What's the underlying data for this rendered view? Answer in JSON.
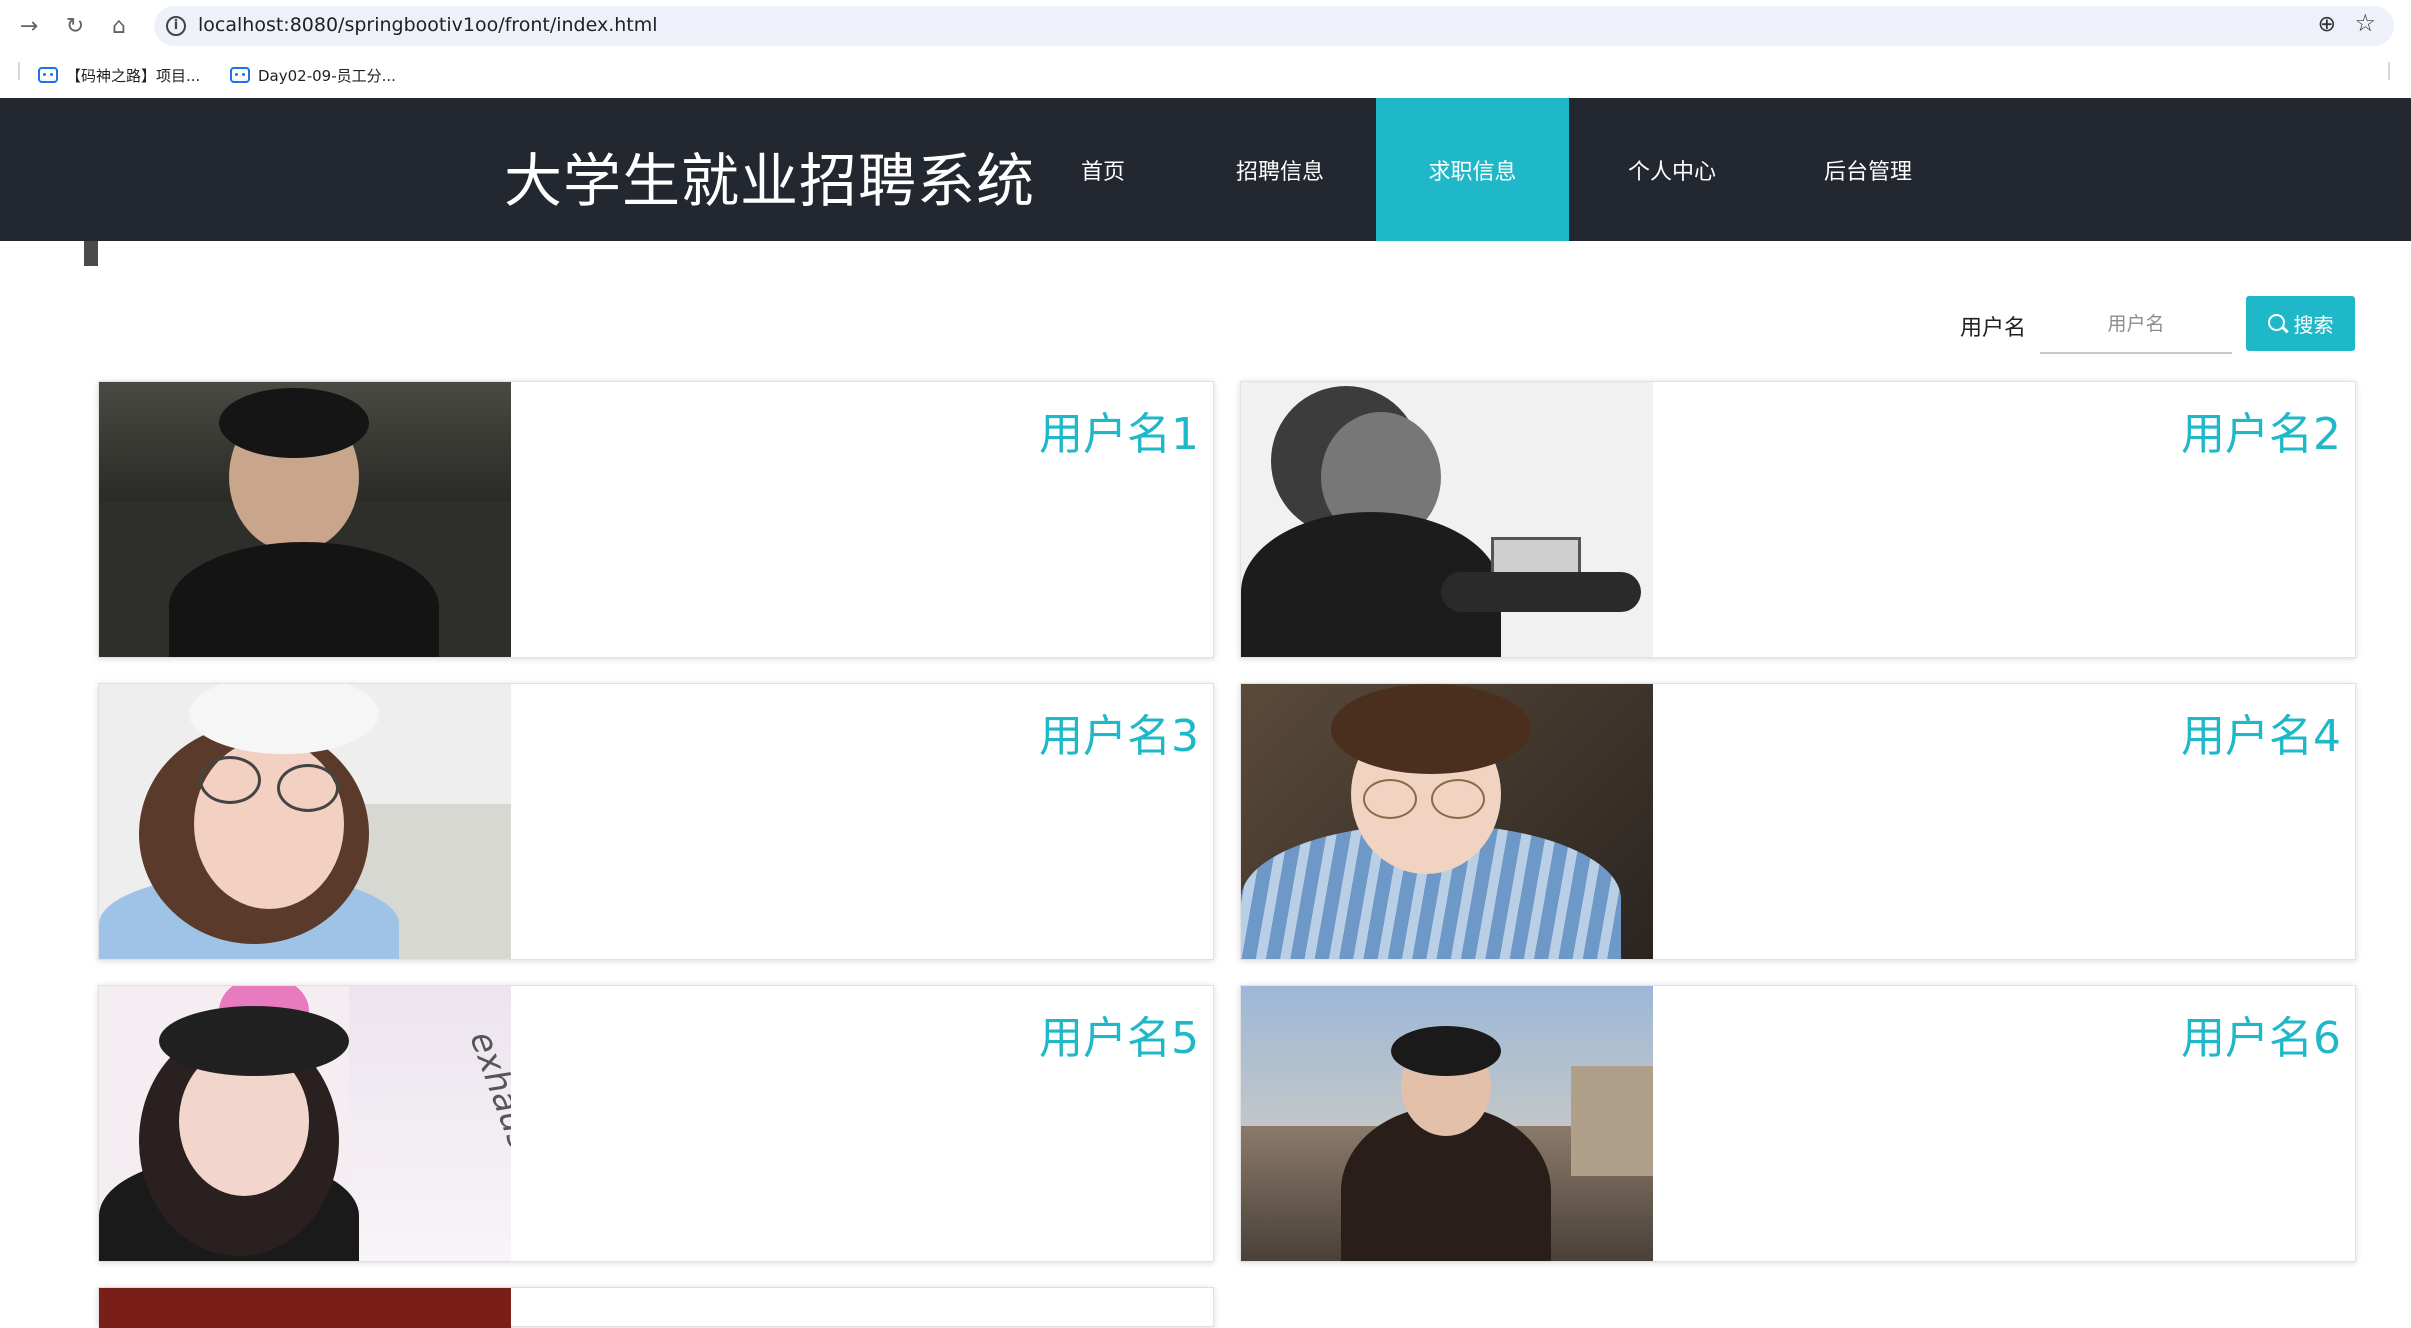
{
  "browser": {
    "url": "localhost:8080/springbootiv1oo/front/index.html",
    "bookmarks": [
      {
        "label": "【码神之路】项目..."
      },
      {
        "label": "Day02-09-员工分..."
      }
    ]
  },
  "header": {
    "title": "大学生就业招聘系统",
    "nav": [
      {
        "label": "首页",
        "active": false
      },
      {
        "label": "招聘信息",
        "active": false
      },
      {
        "label": "求职信息",
        "active": true
      },
      {
        "label": "个人中心",
        "active": false
      },
      {
        "label": "后台管理",
        "active": false
      }
    ]
  },
  "search": {
    "label": "用户名",
    "placeholder": "用户名",
    "button_label": "搜索"
  },
  "cards": [
    {
      "name": "用户名1"
    },
    {
      "name": "用户名2"
    },
    {
      "name": "用户名3"
    },
    {
      "name": "用户名4"
    },
    {
      "name": "用户名5"
    },
    {
      "name": "用户名6"
    }
  ],
  "colors": {
    "accent": "#1fb8c8",
    "header_bg": "#23272f"
  }
}
